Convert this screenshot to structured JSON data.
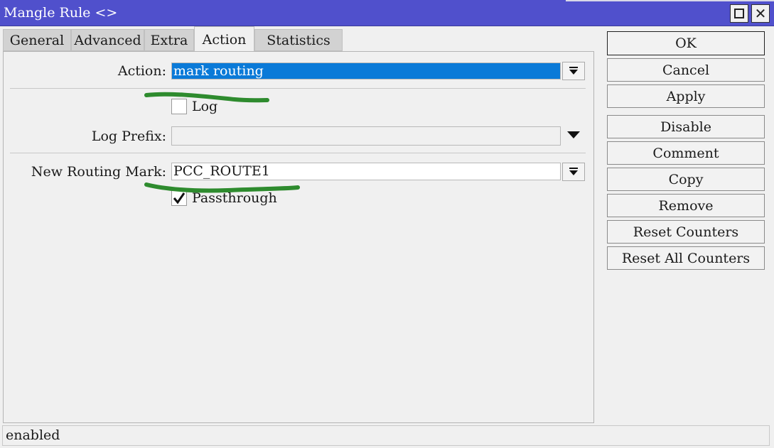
{
  "window": {
    "title": "Mangle Rule <>"
  },
  "tabs": [
    {
      "label": "General"
    },
    {
      "label": "Advanced"
    },
    {
      "label": "Extra"
    },
    {
      "label": "Action",
      "active": true
    },
    {
      "label": "Statistics"
    }
  ],
  "form": {
    "action_label": "Action:",
    "action_value": "mark routing",
    "log_label": "Log",
    "log_checked": false,
    "log_prefix_label": "Log Prefix:",
    "log_prefix_value": "",
    "routing_mark_label": "New Routing Mark:",
    "routing_mark_value": "PCC_ROUTE1",
    "passthrough_label": "Passthrough",
    "passthrough_checked": true
  },
  "buttons": [
    {
      "label": "OK"
    },
    {
      "label": "Cancel"
    },
    {
      "label": "Apply"
    },
    {
      "label": "Disable"
    },
    {
      "label": "Comment"
    },
    {
      "label": "Copy"
    },
    {
      "label": "Remove"
    },
    {
      "label": "Reset Counters"
    },
    {
      "label": "Reset All Counters"
    }
  ],
  "status": {
    "text": "enabled"
  },
  "colors": {
    "titlebar": "#5050cc",
    "selection": "#0a7ad8",
    "annotation": "#2e8b2e"
  }
}
